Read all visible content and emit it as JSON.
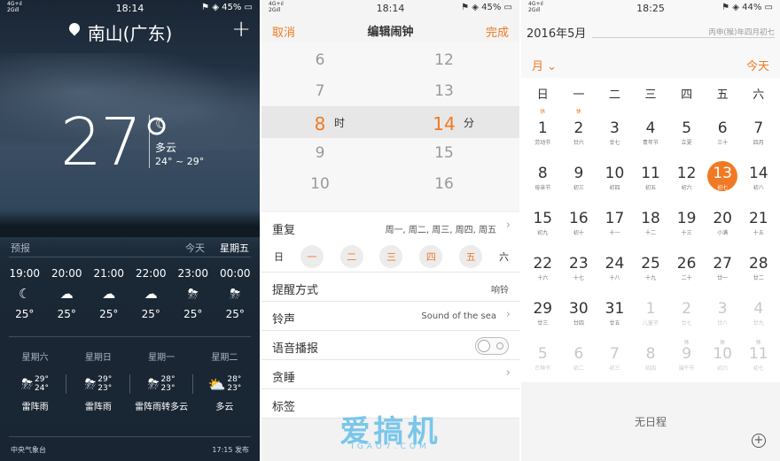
{
  "weather": {
    "status": {
      "signal": "4G+ıl\n2Gıll",
      "time": "18:14",
      "battery": "45%"
    },
    "city": "南山(广东)",
    "add": "+",
    "temp": "27°",
    "cond": "多云",
    "range": "24° ~ 29°",
    "forecast_label": "预报",
    "today_label": "今天",
    "weekday_label": "星期五",
    "hours": [
      {
        "time": "19:00",
        "icon": "moon-cloud-icon",
        "sym": "☾",
        "temp": "25°"
      },
      {
        "time": "20:00",
        "icon": "cloud-icon",
        "sym": "☁",
        "temp": "25°"
      },
      {
        "time": "21:00",
        "icon": "cloud-icon",
        "sym": "☁",
        "temp": "25°"
      },
      {
        "time": "22:00",
        "icon": "cloud-icon",
        "sym": "☁",
        "temp": "25°"
      },
      {
        "time": "23:00",
        "icon": "thunder-rain-icon",
        "sym": "⛈",
        "temp": "25°"
      },
      {
        "time": "00:00",
        "icon": "thunder-rain-icon",
        "sym": "⛈",
        "temp": "25°"
      }
    ],
    "days": [
      {
        "name": "星期六",
        "hi": "29°",
        "lo": "24°",
        "sym": "⛈",
        "desc": "雷阵雨"
      },
      {
        "name": "星期日",
        "hi": "29°",
        "lo": "23°",
        "sym": "⛈",
        "desc": "雷阵雨"
      },
      {
        "name": "星期一",
        "hi": "28°",
        "lo": "23°",
        "sym": "⛈",
        "desc": "雷阵雨转多云"
      },
      {
        "name": "星期二",
        "hi": "28°",
        "lo": "23°",
        "sym": "⛅",
        "desc": "多云"
      }
    ],
    "source": "中央气象台",
    "published": "17:15 发布"
  },
  "alarm": {
    "status": {
      "signal": "4G+ıl\n2Gıll",
      "time": "18:14",
      "battery": "45%"
    },
    "cancel": "取消",
    "title": "编辑闹钟",
    "done": "完成",
    "hours": [
      "6",
      "7",
      "8",
      "9",
      "10"
    ],
    "minutes": [
      "12",
      "13",
      "14",
      "15",
      "16"
    ],
    "hour_unit": "时",
    "minute_unit": "分",
    "repeat_label": "重复",
    "repeat_value": "周一, 周二, 周三, 周四, 周五",
    "weekdays": [
      "日",
      "一",
      "二",
      "三",
      "四",
      "五",
      "六"
    ],
    "remind_label": "提醒方式",
    "remind_value": "响铃",
    "ring_label": "铃声",
    "ring_value": "Sound of the sea",
    "voice_label": "语音播报",
    "snooze_label": "贪睡",
    "tag_label": "标签",
    "watermark": "爱搞机",
    "watermark_sub": "IGAO7.COM"
  },
  "calendar": {
    "status": {
      "signal": "4G+ıl\n2Gıll",
      "time": "18:25",
      "battery": "44%"
    },
    "ym": "2016年5月",
    "lunar": "丙申(猴)年四月初七",
    "month_btn": "月",
    "today_btn": "今天",
    "weekdays": [
      "日",
      "一",
      "二",
      "三",
      "四",
      "五",
      "六"
    ],
    "rest_mark": "休",
    "weeks": [
      [
        {
          "d": "1",
          "l": "劳动节"
        },
        {
          "d": "2",
          "l": "廿六"
        },
        {
          "d": "3",
          "l": "廿七"
        },
        {
          "d": "4",
          "l": "青年节"
        },
        {
          "d": "5",
          "l": "立夏"
        },
        {
          "d": "6",
          "l": "三十"
        },
        {
          "d": "7",
          "l": "四月"
        }
      ],
      [
        {
          "d": "8",
          "l": "母亲节"
        },
        {
          "d": "9",
          "l": "初三"
        },
        {
          "d": "10",
          "l": "初四"
        },
        {
          "d": "11",
          "l": "初五"
        },
        {
          "d": "12",
          "l": "初六"
        },
        {
          "d": "13",
          "l": "初七"
        },
        {
          "d": "14",
          "l": "初八"
        }
      ],
      [
        {
          "d": "15",
          "l": "初九"
        },
        {
          "d": "16",
          "l": "初十"
        },
        {
          "d": "17",
          "l": "十一"
        },
        {
          "d": "18",
          "l": "十二"
        },
        {
          "d": "19",
          "l": "十三"
        },
        {
          "d": "20",
          "l": "小满"
        },
        {
          "d": "21",
          "l": "十五"
        }
      ],
      [
        {
          "d": "22",
          "l": "十六"
        },
        {
          "d": "23",
          "l": "十七"
        },
        {
          "d": "24",
          "l": "十八"
        },
        {
          "d": "25",
          "l": "十九"
        },
        {
          "d": "26",
          "l": "二十"
        },
        {
          "d": "27",
          "l": "廿一"
        },
        {
          "d": "28",
          "l": "廿二"
        }
      ],
      [
        {
          "d": "29",
          "l": "廿三"
        },
        {
          "d": "30",
          "l": "廿四"
        },
        {
          "d": "31",
          "l": "廿五"
        },
        {
          "d": "1",
          "l": "儿童节"
        },
        {
          "d": "2",
          "l": "廿七"
        },
        {
          "d": "3",
          "l": "廿八"
        },
        {
          "d": "4",
          "l": "廿九"
        }
      ],
      [
        {
          "d": "5",
          "l": "芒种节"
        },
        {
          "d": "6",
          "l": "初二"
        },
        {
          "d": "7",
          "l": "初三"
        },
        {
          "d": "8",
          "l": "初四"
        },
        {
          "d": "9",
          "l": "端午节"
        },
        {
          "d": "10",
          "l": "初六"
        },
        {
          "d": "11",
          "l": "初七"
        }
      ]
    ],
    "no_events": "无日程",
    "add": "+"
  }
}
